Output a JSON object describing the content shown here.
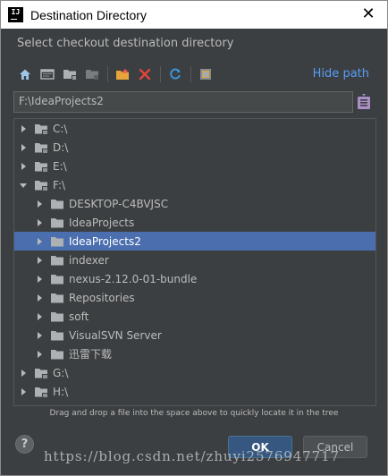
{
  "window": {
    "title": "Destination Directory",
    "app_icon_text": "IJ"
  },
  "subtitle": "Select checkout destination directory",
  "toolbar": {
    "icons": [
      "home-icon",
      "desktop-icon",
      "project-folder-icon",
      "module-folder-icon",
      "new-folder-icon",
      "delete-icon",
      "refresh-icon",
      "show-hidden-icon"
    ],
    "hide_path_label": "Hide path"
  },
  "path": {
    "value": "F:\\IdeaProjects2"
  },
  "tree": {
    "items": [
      {
        "label": "C:\\",
        "level": 0,
        "expanded": false,
        "selected": false,
        "kind": "drive"
      },
      {
        "label": "D:\\",
        "level": 0,
        "expanded": false,
        "selected": false,
        "kind": "drive"
      },
      {
        "label": "E:\\",
        "level": 0,
        "expanded": false,
        "selected": false,
        "kind": "drive"
      },
      {
        "label": "F:\\",
        "level": 0,
        "expanded": true,
        "selected": false,
        "kind": "drive"
      },
      {
        "label": "DESKTOP-C4BVJSC",
        "level": 1,
        "expanded": false,
        "selected": false,
        "kind": "folder"
      },
      {
        "label": "IdeaProjects",
        "level": 1,
        "expanded": false,
        "selected": false,
        "kind": "folder"
      },
      {
        "label": "IdeaProjects2",
        "level": 1,
        "expanded": false,
        "selected": true,
        "kind": "folder"
      },
      {
        "label": "indexer",
        "level": 1,
        "expanded": false,
        "selected": false,
        "kind": "folder"
      },
      {
        "label": "nexus-2.12.0-01-bundle",
        "level": 1,
        "expanded": false,
        "selected": false,
        "kind": "folder"
      },
      {
        "label": "Repositories",
        "level": 1,
        "expanded": false,
        "selected": false,
        "kind": "folder"
      },
      {
        "label": "soft",
        "level": 1,
        "expanded": false,
        "selected": false,
        "kind": "folder"
      },
      {
        "label": "VisualSVN Server",
        "level": 1,
        "expanded": false,
        "selected": false,
        "kind": "folder"
      },
      {
        "label": "迅雷下载",
        "level": 1,
        "expanded": false,
        "selected": false,
        "kind": "folder"
      },
      {
        "label": "G:\\",
        "level": 0,
        "expanded": false,
        "selected": false,
        "kind": "drive"
      },
      {
        "label": "H:\\",
        "level": 0,
        "expanded": false,
        "selected": false,
        "kind": "drive"
      }
    ]
  },
  "hint": "Drag and drop a file into the space above to quickly locate it in the tree",
  "buttons": {
    "help_label": "?",
    "ok_label": "OK",
    "cancel_label": "Cancel"
  },
  "watermark": "https://blog.csdn.net/zhuyi2576947717",
  "colors": {
    "background": "#3c3f41",
    "selection": "#4b6eaf",
    "link": "#589df6",
    "ok_button": "#365880",
    "text": "#bbbbbb"
  }
}
